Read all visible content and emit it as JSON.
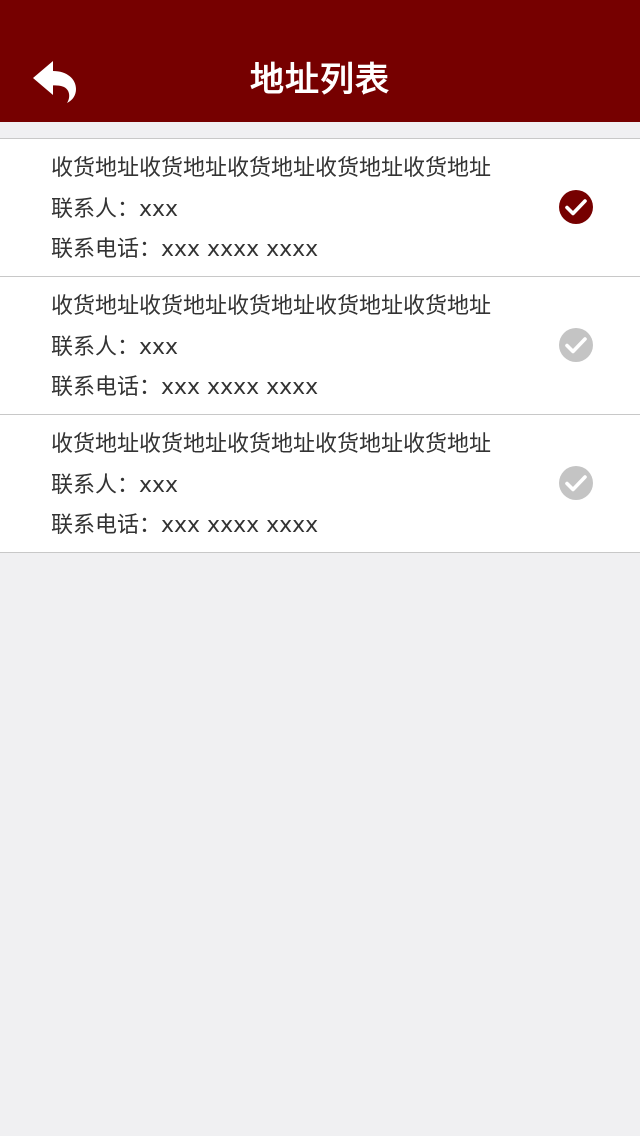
{
  "header": {
    "title": "地址列表",
    "back_icon": "back-arrow-icon",
    "background": "#760000"
  },
  "addresses": [
    {
      "address": "收货地址收货地址收货地址收货地址收货地址",
      "contact": "联系人：xxx",
      "phone": "联系电话：xxx xxxx xxxx",
      "selected": true,
      "status_icon": "check-circle-icon"
    },
    {
      "address": "收货地址收货地址收货地址收货地址收货地址",
      "contact": "联系人：xxx",
      "phone": "联系电话：xxx xxxx xxxx",
      "selected": false,
      "status_icon": "check-circle-icon"
    },
    {
      "address": "收货地址收货地址收货地址收货地址收货地址",
      "contact": "联系人：xxx",
      "phone": "联系电话：xxx xxxx xxxx",
      "selected": false,
      "status_icon": "check-circle-icon"
    }
  ],
  "colors": {
    "accent": "#760000",
    "check_unselected": "#c4c4c4",
    "page_background": "#f0f0f2",
    "text": "#333333"
  }
}
